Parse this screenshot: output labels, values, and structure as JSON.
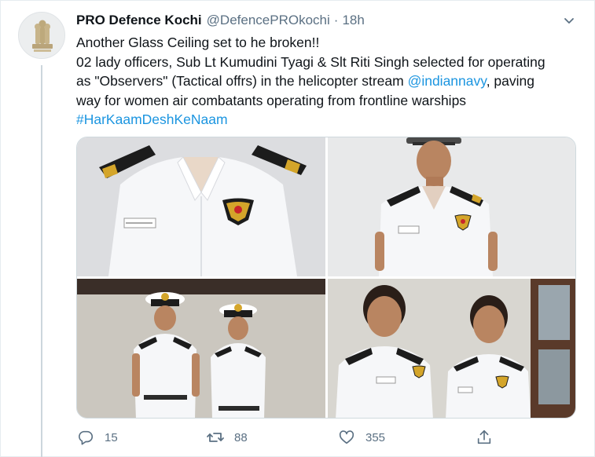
{
  "tweet": {
    "display_name": "PRO Defence Kochi",
    "handle": "@DefencePROkochi",
    "separator": "·",
    "time": "18h",
    "lines": {
      "l1": "Another Glass Ceiling set to he broken!!",
      "l2": "02 lady officers, Sub Lt Kumudini Tyagi & Slt Riti Singh selected for operating",
      "l3_a": "as \"Observers\" (Tactical offrs) in the helicopter stream ",
      "l3_mention": "@indiannavy",
      "l3_b": ", paving",
      "l4": "way for women air combatants operating from frontline warships",
      "hashtag": "#HarKaamDeshKeNaam"
    }
  },
  "actions": {
    "reply_count": "15",
    "retweet_count": "88",
    "like_count": "355"
  },
  "icons": {
    "more": "chevron-down-icon",
    "reply": "reply-icon",
    "retweet": "retweet-icon",
    "like": "heart-icon",
    "share": "share-icon"
  },
  "colors": {
    "link": "#1b95e0",
    "secondary_text": "#5b7083",
    "uniform_white": "#f4f5f7",
    "epaulette": "#1c1c1c",
    "gold": "#d4a52a"
  }
}
